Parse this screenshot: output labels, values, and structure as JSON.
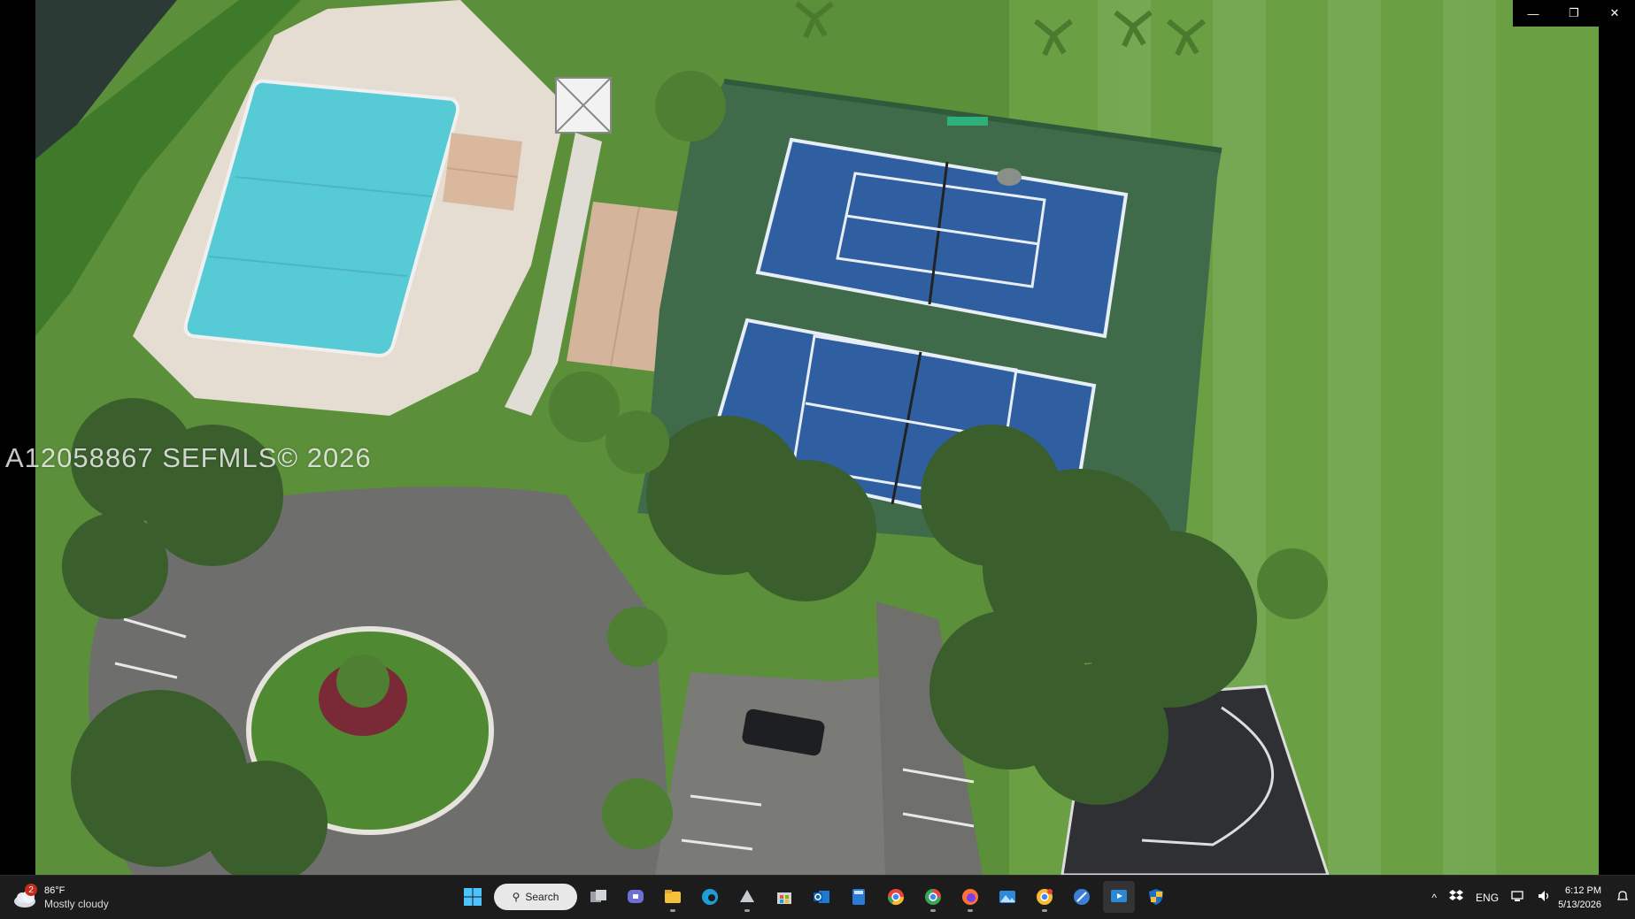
{
  "photo": {
    "alt_subject": "aerial-amenities-photo",
    "watermark": "A12058867  SEFMLS© 2026"
  },
  "window_controls": {
    "minimize": "—",
    "restore": "❐",
    "close": "✕"
  },
  "taskbar": {
    "weather": {
      "badge": "2",
      "temperature": "86°F",
      "condition": "Mostly cloudy"
    },
    "search_label": "Search",
    "apps": [
      {
        "name": "start-icon"
      },
      {
        "name": "task-view-icon"
      },
      {
        "name": "teams-icon"
      },
      {
        "name": "file-explorer-icon"
      },
      {
        "name": "edge-icon"
      },
      {
        "name": "devices-icon"
      },
      {
        "name": "store-icon"
      },
      {
        "name": "outlook-icon"
      },
      {
        "name": "calculator-icon"
      },
      {
        "name": "chrome-icon"
      },
      {
        "name": "chrome-alt-icon"
      },
      {
        "name": "firefox-icon"
      },
      {
        "name": "photos-icon"
      },
      {
        "name": "chrome-canary-icon"
      },
      {
        "name": "snipping-icon"
      },
      {
        "name": "media-player-icon"
      },
      {
        "name": "security-icon"
      }
    ],
    "tray": {
      "chevron": "^",
      "language": "ENG",
      "time": "6:12 PM",
      "date": "5/13/2026"
    }
  },
  "colors": {
    "court_green": "#3f6b4a",
    "court_blue": "#2f5fa0",
    "pool": "#5fd3dc",
    "grass": "#5e9a3e",
    "taskbar": "#1c1c1c"
  }
}
